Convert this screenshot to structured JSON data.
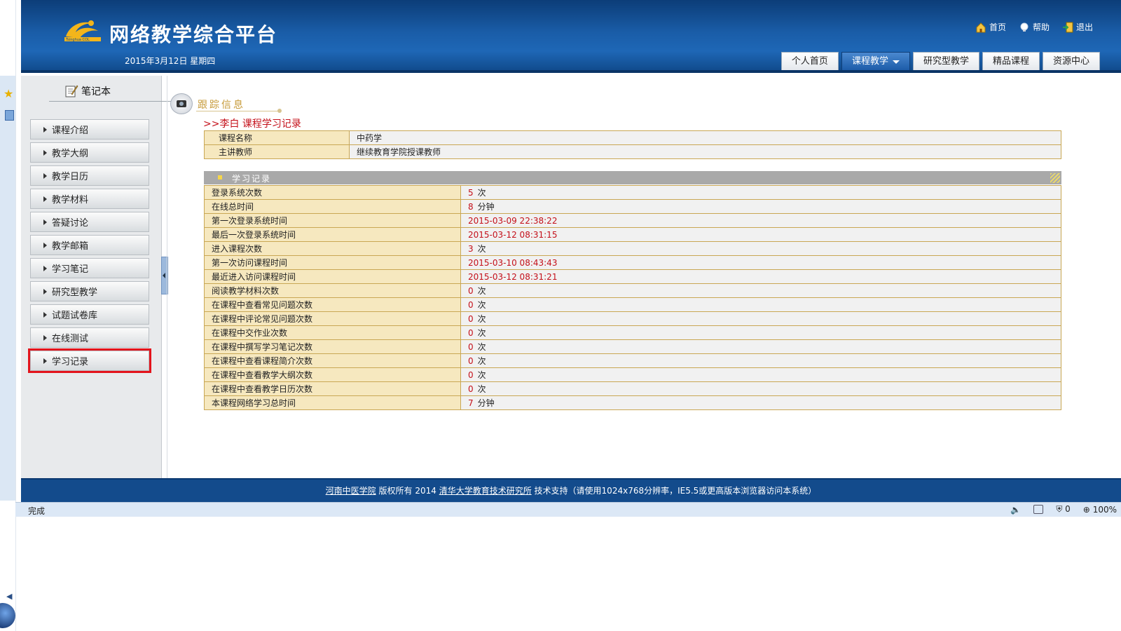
{
  "header": {
    "site_title": "网络教学综合平台",
    "logo_text": "Tsinghua COL",
    "date": "2015年3月12日 星期四",
    "links": {
      "home": "首页",
      "help": "帮助",
      "logout": "退出"
    },
    "tabs": [
      {
        "label": "个人首页",
        "active": false
      },
      {
        "label": "课程教学",
        "active": true
      },
      {
        "label": "研究型教学",
        "active": false
      },
      {
        "label": "精品课程",
        "active": false
      },
      {
        "label": "资源中心",
        "active": false
      }
    ]
  },
  "sidebar": {
    "notebook_label": "笔记本",
    "items": [
      {
        "label": "课程介绍"
      },
      {
        "label": "教学大纲"
      },
      {
        "label": "教学日历"
      },
      {
        "label": "教学材料"
      },
      {
        "label": "答疑讨论"
      },
      {
        "label": "教学邮箱"
      },
      {
        "label": "学习笔记"
      },
      {
        "label": "研究型教学"
      },
      {
        "label": "试题试卷库"
      },
      {
        "label": "在线测试"
      },
      {
        "label": "学习记录",
        "selected": true
      }
    ]
  },
  "main": {
    "section_title": "跟踪信息",
    "record_heading": ">>李白  课程学习记录",
    "course_info": [
      {
        "label": "课程名称",
        "value": "中药学"
      },
      {
        "label": "主讲教师",
        "value": "继续教育学院授课教师"
      }
    ],
    "records_title": "学习记录",
    "records": [
      {
        "label": "登录系统次数",
        "value": "5",
        "unit": "次"
      },
      {
        "label": "在线总时间",
        "value": "8",
        "unit": "分钟"
      },
      {
        "label": "第一次登录系统时间",
        "value": "2015-03-09 22:38:22",
        "unit": ""
      },
      {
        "label": "最后一次登录系统时间",
        "value": "2015-03-12 08:31:15",
        "unit": ""
      },
      {
        "label": "进入课程次数",
        "value": "3",
        "unit": "次"
      },
      {
        "label": "第一次访问课程时间",
        "value": "2015-03-10 08:43:43",
        "unit": ""
      },
      {
        "label": "最近进入访问课程时间",
        "value": "2015-03-12 08:31:21",
        "unit": ""
      },
      {
        "label": "阅读教学材料次数",
        "value": "0",
        "unit": "次"
      },
      {
        "label": "在课程中查看常见问题次数",
        "value": "0",
        "unit": "次"
      },
      {
        "label": "在课程中评论常见问题次数",
        "value": "0",
        "unit": "次"
      },
      {
        "label": "在课程中交作业次数",
        "value": "0",
        "unit": "次"
      },
      {
        "label": "在课程中撰写学习笔记次数",
        "value": "0",
        "unit": "次"
      },
      {
        "label": "在课程中查看课程简介次数",
        "value": "0",
        "unit": "次"
      },
      {
        "label": "在课程中查看教学大纲次数",
        "value": "0",
        "unit": "次"
      },
      {
        "label": "在课程中查看教学日历次数",
        "value": "0",
        "unit": "次"
      },
      {
        "label": "本课程网络学习总时间",
        "value": "7",
        "unit": "分钟"
      }
    ]
  },
  "footer": {
    "org_link": "河南中医学院",
    "copyright": "版权所有 2014",
    "support_link": "清华大学教育技术研究所",
    "support_text": "技术支持（请使用1024x768分辨率，IE5.5或更高版本浏览器访问本系统）"
  },
  "statusbar": {
    "status": "完成",
    "blocked_count": "0",
    "zoom": "100%"
  }
}
